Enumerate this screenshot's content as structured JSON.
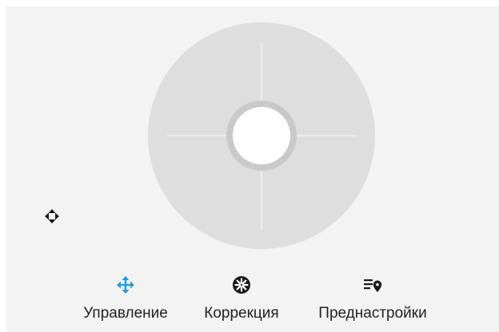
{
  "colors": {
    "panel_background": "#f3f3f3",
    "joystick_pad": "#dedede",
    "joystick_ring": "#c9c9c9",
    "accent": "#1e9be8",
    "icon_dark": "#1a1a1a",
    "label_text": "#222222"
  },
  "joystick": {
    "icon": "directional-pad"
  },
  "view_toggle": {
    "icon": "four-way-arrows-icon"
  },
  "tabs": [
    {
      "label": "Управление",
      "icon": "move-arrows-icon",
      "active": true
    },
    {
      "label": "Коррекция",
      "icon": "aperture-icon",
      "active": false
    },
    {
      "label": "Преднастройки",
      "icon": "list-location-icon",
      "active": false
    }
  ]
}
